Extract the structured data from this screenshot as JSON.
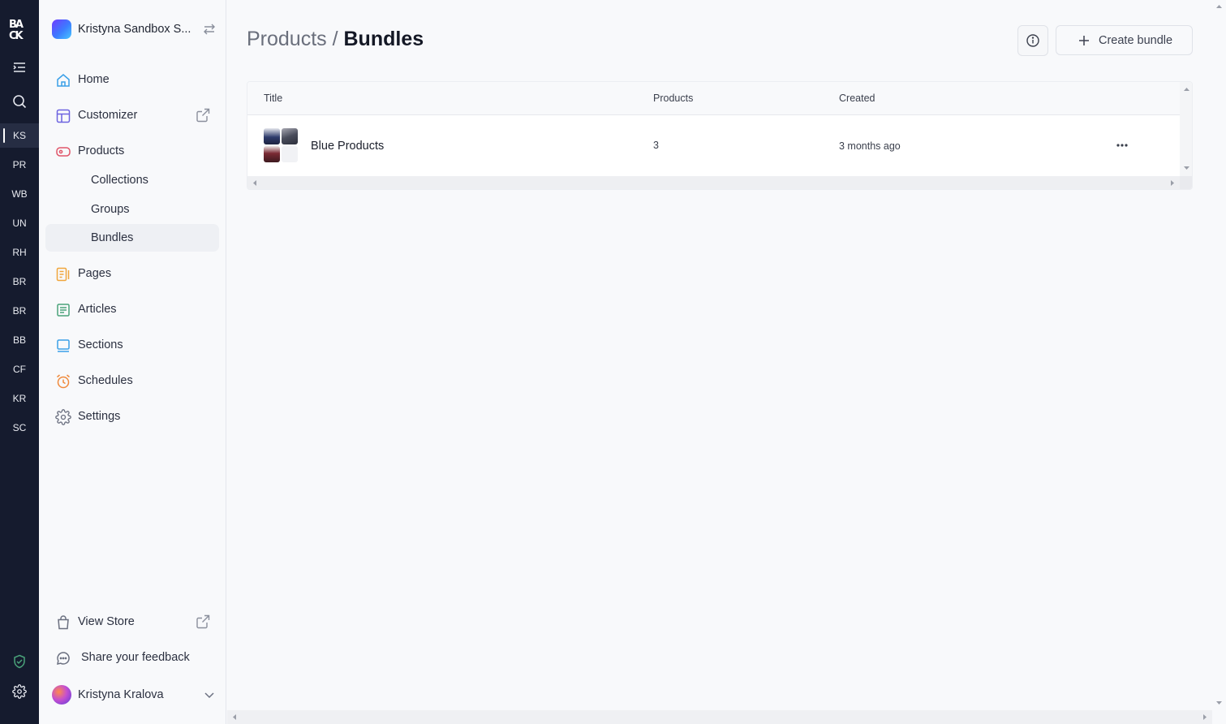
{
  "rail": {
    "logo_text": "BACK",
    "stores": [
      "KS",
      "PR",
      "WB",
      "UN",
      "RH",
      "BR",
      "BR",
      "BB",
      "CF",
      "KR",
      "SC"
    ],
    "active_store": "KS"
  },
  "sidebar": {
    "workspace_name": "Kristyna Sandbox S...",
    "nav": {
      "home": "Home",
      "customizer": "Customizer",
      "products": "Products",
      "collections": "Collections",
      "groups": "Groups",
      "bundles": "Bundles",
      "pages": "Pages",
      "articles": "Articles",
      "sections": "Sections",
      "schedules": "Schedules",
      "settings": "Settings"
    },
    "footer": {
      "view_store": "View Store",
      "feedback": "Share your feedback",
      "user_name": "Kristyna Kralova"
    }
  },
  "main": {
    "breadcrumb_parent": "Products / ",
    "breadcrumb_current": "Bundles",
    "create_label": "Create bundle",
    "table": {
      "columns": {
        "title": "Title",
        "products": "Products",
        "created": "Created"
      },
      "rows": [
        {
          "title": "Blue Products",
          "products": "3",
          "created": "3 months ago"
        }
      ]
    }
  },
  "colors": {
    "rail_bg": "#151b2e",
    "accent_home": "#3aa0e8",
    "accent_customizer": "#6c63e0",
    "accent_products": "#e0566a",
    "accent_pages": "#f0a63c",
    "accent_articles": "#4aa37a",
    "accent_sections": "#3aa0e8",
    "accent_schedules": "#f08a3c"
  }
}
